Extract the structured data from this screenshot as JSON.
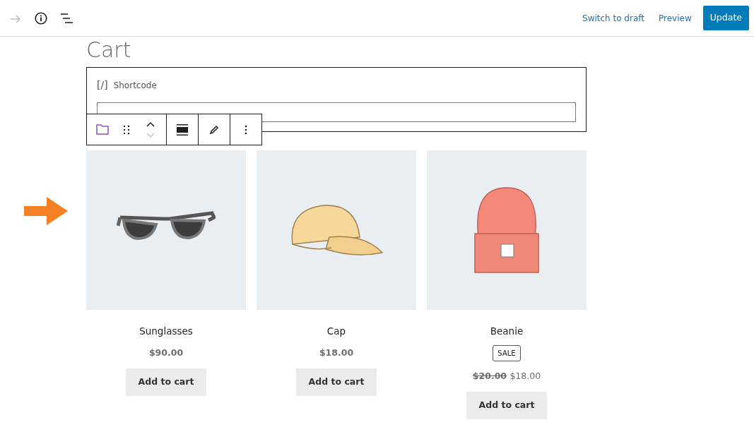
{
  "top_bar": {
    "tools": [
      {
        "kind": "redo",
        "disabled": true
      },
      {
        "kind": "info",
        "disabled": false
      },
      {
        "kind": "outline",
        "disabled": false
      }
    ],
    "switch_to_draft": "Switch to draft",
    "preview": "Preview",
    "update": "Update"
  },
  "page_title": "Cart",
  "shortcode_block": {
    "label": "Shortcode",
    "icon_text": "[/]"
  },
  "block_toolbar": {
    "tools": [
      {
        "kind": "folder"
      },
      {
        "kind": "drag"
      },
      {
        "kind": "move"
      },
      {
        "kind": "align"
      },
      {
        "kind": "edit"
      },
      {
        "kind": "more"
      }
    ]
  },
  "products": [
    {
      "kind": "sunglasses",
      "name": "Sunglasses",
      "on_sale": false,
      "price": "$90.00",
      "button": "Add to cart"
    },
    {
      "kind": "cap",
      "name": "Cap",
      "on_sale": false,
      "price": "$18.00",
      "button": "Add to cart"
    },
    {
      "kind": "beanie",
      "name": "Beanie",
      "on_sale": true,
      "sale_badge": "SALE",
      "old_price": "$20.00",
      "price": "$18.00",
      "button": "Add to cart"
    }
  ]
}
